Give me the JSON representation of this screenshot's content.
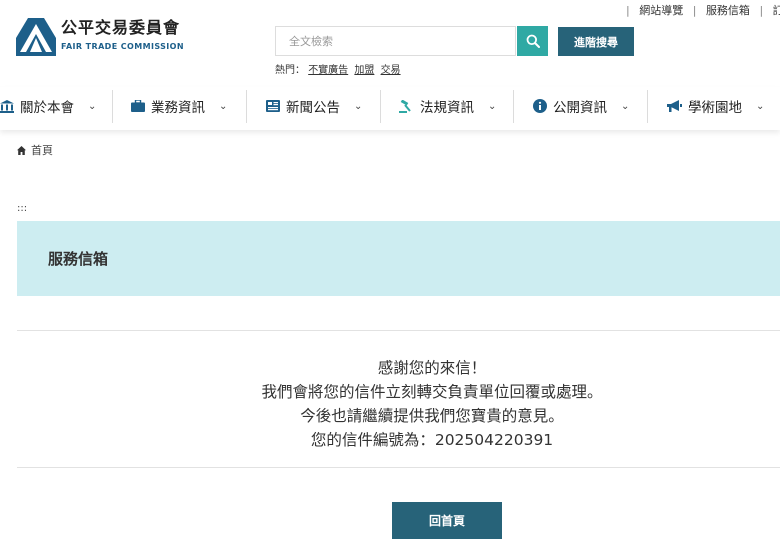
{
  "top_links": [
    "網站導覽",
    "服務信箱",
    "訂閱"
  ],
  "logo": {
    "name_zh": "公平交易委員會",
    "name_en": "FAIR TRADE COMMISSION"
  },
  "search": {
    "placeholder": "全文檢索",
    "advanced_label": "進階搜尋"
  },
  "hot": {
    "label": "熱門：",
    "keywords": [
      "不實廣告",
      "加盟",
      "交易"
    ]
  },
  "nav": [
    {
      "label": "關於本會",
      "icon": "building-icon"
    },
    {
      "label": "業務資訊",
      "icon": "briefcase-icon"
    },
    {
      "label": "新聞公告",
      "icon": "newspaper-icon"
    },
    {
      "label": "法規資訊",
      "icon": "gavel-icon"
    },
    {
      "label": "公開資訊",
      "icon": "info-icon"
    },
    {
      "label": "學術園地",
      "icon": "megaphone-icon"
    }
  ],
  "breadcrumb": {
    "home": "首頁"
  },
  "accesskey": ":::",
  "page_title": "服務信箱",
  "message": {
    "line1": "感謝您的來信！",
    "line2": "我們會將您的信件立刻轉交負責單位回覆或處理。",
    "line3": "今後也請繼續提供我們您寶貴的意見。",
    "line4": "您的信件編號為：202504220391"
  },
  "home_button": "回首頁",
  "colors": {
    "brand_blue": "#1d5f8a",
    "search_teal": "#2fa9a4",
    "button_dark_teal": "#276379",
    "panel_bg": "#cdedf1"
  }
}
